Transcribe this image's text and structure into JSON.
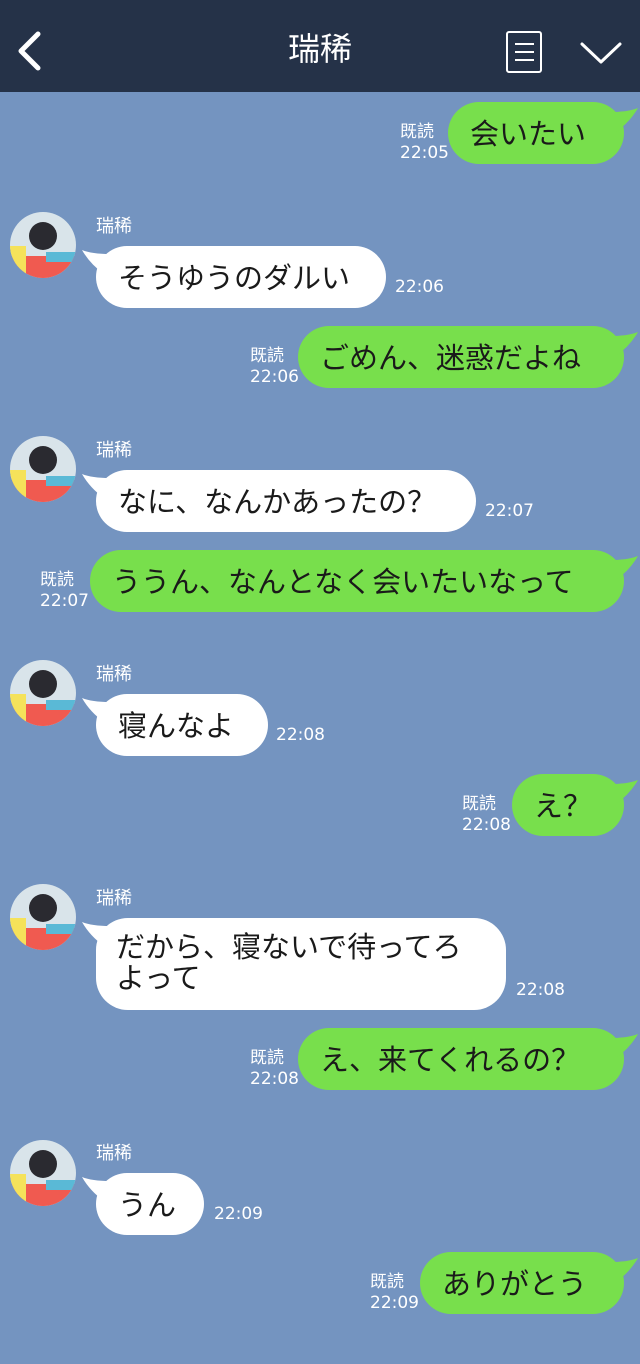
{
  "header": {
    "title": "瑞稀"
  },
  "messages": [
    {
      "dir": "out",
      "text": "会いたい",
      "read": "既読",
      "time": "22:05"
    },
    {
      "dir": "in",
      "sender": "瑞稀",
      "text": "そうゆうのダルい",
      "time": "22:06"
    },
    {
      "dir": "out",
      "text": "ごめん、迷惑だよね",
      "read": "既読",
      "time": "22:06"
    },
    {
      "dir": "in",
      "sender": "瑞稀",
      "text": "なに、なんかあったの？",
      "time": "22:07"
    },
    {
      "dir": "out",
      "text": "ううん、なんとなく会いたいなって",
      "read": "既読",
      "time": "22:07"
    },
    {
      "dir": "in",
      "sender": "瑞稀",
      "text": "寝んなよ",
      "time": "22:08"
    },
    {
      "dir": "out",
      "text": "え？",
      "read": "既読",
      "time": "22:08"
    },
    {
      "dir": "in",
      "sender": "瑞稀",
      "text_line1": "だから、寝ないで待ってろ",
      "text_line2": "よって",
      "time": "22:08"
    },
    {
      "dir": "out",
      "text": "え、来てくれるの？",
      "read": "既読",
      "time": "22:08"
    },
    {
      "dir": "in",
      "sender": "瑞稀",
      "text": "うん",
      "time": "22:09"
    },
    {
      "dir": "out",
      "text": "ありがとう",
      "read": "既読",
      "time": "22:09"
    }
  ],
  "colors": {
    "header": "#253248",
    "background": "#7494c0",
    "outgoing": "#78df4c",
    "incoming": "#ffffff"
  },
  "icons": {
    "back": "chevron-left-icon",
    "menu": "menu-list-icon",
    "collapse": "chevron-down-icon",
    "avatar": "avatar"
  }
}
